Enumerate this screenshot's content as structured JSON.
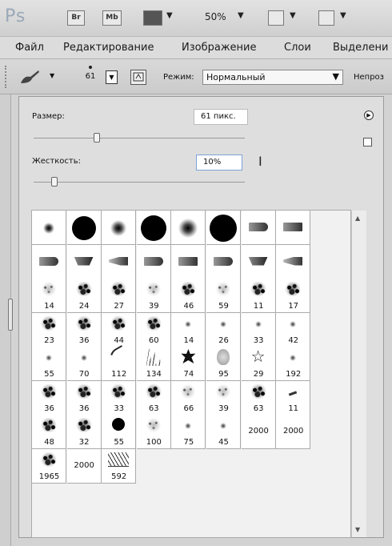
{
  "app": {
    "logo": "Ps",
    "bridge_button": "Br",
    "minibridge_button": "Mb",
    "zoom": "50%"
  },
  "menu": [
    "Файл",
    "Редактирование",
    "Изображение",
    "Слои",
    "Выделени"
  ],
  "options": {
    "brush_size": "61",
    "mode_label": "Режим:",
    "mode_value": "Нормальный",
    "opacity_label": "Непроз"
  },
  "picker": {
    "size_label": "Размер:",
    "size_value": "61 пикс.",
    "hardness_label": "Жесткость:",
    "hardness_value": "10%",
    "size_slider_fraction": 0.3,
    "hardness_slider_fraction": 0.1
  },
  "brushes": [
    {
      "kind": "soft",
      "d": 14
    },
    {
      "kind": "hard",
      "d": 30
    },
    {
      "kind": "soft",
      "d": 20
    },
    {
      "kind": "hard",
      "d": 32
    },
    {
      "kind": "soft",
      "d": 24
    },
    {
      "kind": "hard",
      "d": 34
    },
    {
      "kind": "tip",
      "style": "bullet"
    },
    {
      "kind": "tip",
      "style": "rect"
    },
    {
      "kind": "tip",
      "style": "bullet"
    },
    {
      "kind": "tip",
      "style": "wedge"
    },
    {
      "kind": "tip",
      "style": "fan"
    },
    {
      "kind": "tip",
      "style": "bullet"
    },
    {
      "kind": "tip",
      "style": "rect"
    },
    {
      "kind": "tip",
      "style": "bullet"
    },
    {
      "kind": "tip",
      "style": "wedge"
    },
    {
      "kind": "tip",
      "style": "fan"
    },
    {
      "kind": "scatter",
      "style": "light",
      "n": "14"
    },
    {
      "kind": "scatter",
      "style": "dense",
      "n": "24"
    },
    {
      "kind": "scatter",
      "style": "dense",
      "n": "27"
    },
    {
      "kind": "scatter",
      "style": "light",
      "n": "39"
    },
    {
      "kind": "scatter",
      "style": "dense",
      "n": "46"
    },
    {
      "kind": "scatter",
      "style": "light",
      "n": "59"
    },
    {
      "kind": "scatter",
      "style": "dense",
      "n": "11"
    },
    {
      "kind": "scatter",
      "style": "dense",
      "n": "17"
    },
    {
      "kind": "scatter",
      "style": "dense",
      "n": "23"
    },
    {
      "kind": "scatter",
      "style": "dense",
      "n": "36"
    },
    {
      "kind": "scatter",
      "style": "dense",
      "n": "44"
    },
    {
      "kind": "scatter",
      "style": "dense",
      "n": "60"
    },
    {
      "kind": "scatter",
      "style": "dot",
      "n": "14"
    },
    {
      "kind": "scatter",
      "style": "dot",
      "n": "26"
    },
    {
      "kind": "scatter",
      "style": "dot",
      "n": "33"
    },
    {
      "kind": "scatter",
      "style": "dot",
      "n": "42"
    },
    {
      "kind": "scatter",
      "style": "dot",
      "n": "55"
    },
    {
      "kind": "scatter",
      "style": "dot",
      "n": "70"
    },
    {
      "kind": "scatter",
      "style": "stroke",
      "n": "112"
    },
    {
      "kind": "scatter",
      "style": "grass",
      "n": "134"
    },
    {
      "kind": "scatter",
      "style": "leaf",
      "n": "74"
    },
    {
      "kind": "scatter",
      "style": "petal",
      "n": "95"
    },
    {
      "kind": "star",
      "n": "29"
    },
    {
      "kind": "scatter",
      "style": "dot",
      "n": "192"
    },
    {
      "kind": "scatter",
      "style": "dense",
      "n": "36"
    },
    {
      "kind": "scatter",
      "style": "dense",
      "n": "36"
    },
    {
      "kind": "scatter",
      "style": "dense",
      "n": "33"
    },
    {
      "kind": "scatter",
      "style": "dense",
      "n": "63"
    },
    {
      "kind": "scatter",
      "style": "light",
      "n": "66"
    },
    {
      "kind": "scatter",
      "style": "light",
      "n": "39"
    },
    {
      "kind": "scatter",
      "style": "dense",
      "n": "63"
    },
    {
      "kind": "scatter",
      "style": "dash",
      "n": "11"
    },
    {
      "kind": "scatter",
      "style": "dense",
      "n": "48"
    },
    {
      "kind": "scatter",
      "style": "dense",
      "n": "32"
    },
    {
      "kind": "hard-n",
      "d": 16,
      "n": "55"
    },
    {
      "kind": "scatter",
      "style": "light",
      "n": "100"
    },
    {
      "kind": "scatter",
      "style": "dot",
      "n": "75"
    },
    {
      "kind": "scatter",
      "style": "dot",
      "n": "45"
    },
    {
      "kind": "num",
      "n": "2000"
    },
    {
      "kind": "num",
      "n": "2000"
    },
    {
      "kind": "scatter",
      "style": "dense",
      "n": "1965"
    },
    {
      "kind": "num",
      "n": "2000"
    },
    {
      "kind": "scatter",
      "style": "sig",
      "n": "592"
    }
  ]
}
